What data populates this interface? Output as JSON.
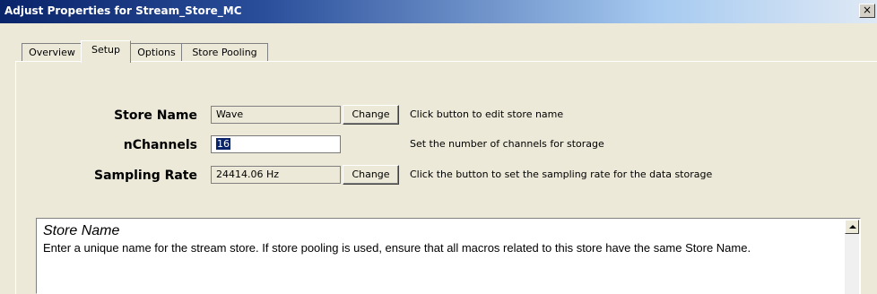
{
  "window": {
    "title": "Adjust Properties for Stream_Store_MC",
    "close_glyph": "×"
  },
  "tabs": [
    {
      "label": "Overview"
    },
    {
      "label": "Setup"
    },
    {
      "label": "Options"
    },
    {
      "label": "Store Pooling"
    }
  ],
  "active_tab": "Setup",
  "setup": {
    "store_name": {
      "label": "Store Name",
      "value": "Wave",
      "button": "Change",
      "hint": "Click button to edit store name"
    },
    "nchannels": {
      "label": "nChannels",
      "value": "16",
      "hint": "Set the number of channels for storage"
    },
    "sampling_rate": {
      "label": "Sampling Rate",
      "value": "24414.06 Hz",
      "button": "Change",
      "hint": "Click the button to set the sampling rate for the data storage"
    }
  },
  "help": {
    "title": "Store Name",
    "text": "Enter a unique name for the stream store. If store pooling is used, ensure that all macros related to this store have the same Store Name."
  },
  "colors": {
    "titlebar_start": "#0a246a",
    "dialog_bg": "#ece9d8",
    "selection": "#0a246a"
  }
}
